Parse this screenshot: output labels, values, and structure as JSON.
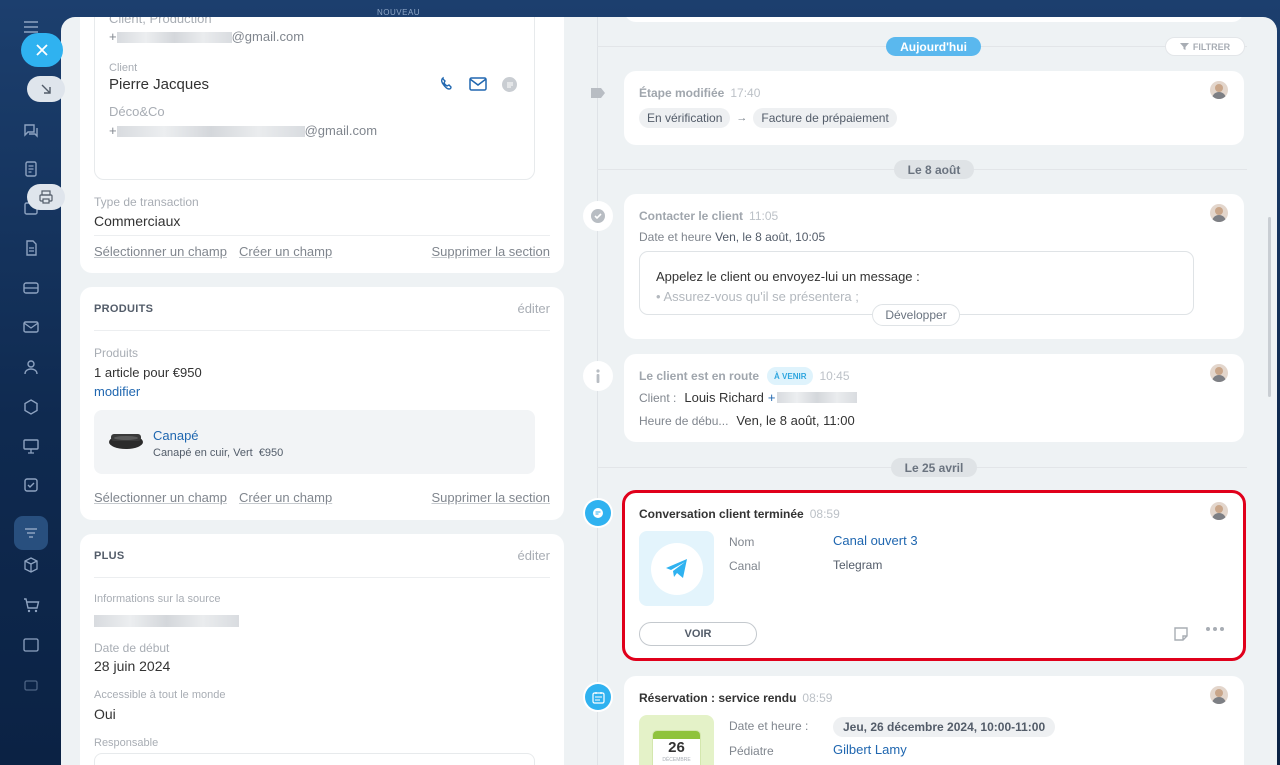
{
  "topbar": {
    "nouveau": "NOUVEAU"
  },
  "left": {
    "contact_top": {
      "role": "Client, Production",
      "email_suffix": "@gmail.com",
      "plus": "+"
    },
    "client": {
      "label": "Client",
      "name": "Pierre Jacques",
      "company": "Déco&Co",
      "plus": "+",
      "email_suffix": "@gmail.com"
    },
    "transaction": {
      "label": "Type de transaction",
      "value": "Commerciaux"
    },
    "actions": {
      "select": "Sélectionner un champ",
      "create": "Créer un champ",
      "delete": "Supprimer la section"
    },
    "products": {
      "title": "PRODUITS",
      "edit": "éditer",
      "label": "Produits",
      "summary": "1 article pour €950",
      "modify": "modifier",
      "item_name": "Canapé",
      "item_desc": "Canapé en cuir, Vert",
      "item_price": "€950"
    },
    "plus": {
      "title": "PLUS",
      "edit": "éditer",
      "source_label": "Informations sur la source",
      "start_label": "Date de début",
      "start_value": "28 juin 2024",
      "access_label": "Accessible à tout le monde",
      "access_value": "Oui",
      "resp_label": "Responsable"
    }
  },
  "timeline": {
    "today": "Aujourd'hui",
    "filter": "FILTRER",
    "stage": {
      "title": "Étape modifiée",
      "time": "17:40",
      "from": "En vérification",
      "arrow": "→",
      "to": "Facture de prépaiement"
    },
    "date1": "Le 8 août",
    "contact": {
      "title": "Contacter le client",
      "time": "11:05",
      "date_label": "Date et heure",
      "date_value": "Ven, le 8 août, 10:05",
      "message": "Appelez le client ou envoyez-lui un message :",
      "message2": "• Assurez-vous qu'il se présentera ;",
      "expand": "Développer"
    },
    "route": {
      "title": "Le client est en route",
      "badge": "À VENIR",
      "time": "10:45",
      "client_label": "Client :",
      "client_value": "Louis Richard",
      "client_plus": "+",
      "start_label": "Heure de débu...",
      "start_value": "Ven, le 8 août, 11:00"
    },
    "date2": "Le 25 avril",
    "conversation": {
      "title": "Conversation client terminée",
      "time": "08:59",
      "name_label": "Nom",
      "name_value": "Canal ouvert 3",
      "channel_label": "Canal",
      "channel_value": "Telegram",
      "view": "VOIR"
    },
    "booking": {
      "title": "Réservation : service rendu",
      "time": "08:59",
      "date_label": "Date et heure :",
      "date_value": "Jeu, 26 décembre 2024, 10:00-11:00",
      "ped_label": "Pédiatre",
      "ped_value": "Gilbert Lamy",
      "cal_day": "26",
      "cal_month": "DÉCEMBRE"
    }
  },
  "colors": {
    "accent": "#2fb2f0",
    "link": "#2067b0",
    "highlight": "#e0001b",
    "today": "#5ab8ee"
  }
}
